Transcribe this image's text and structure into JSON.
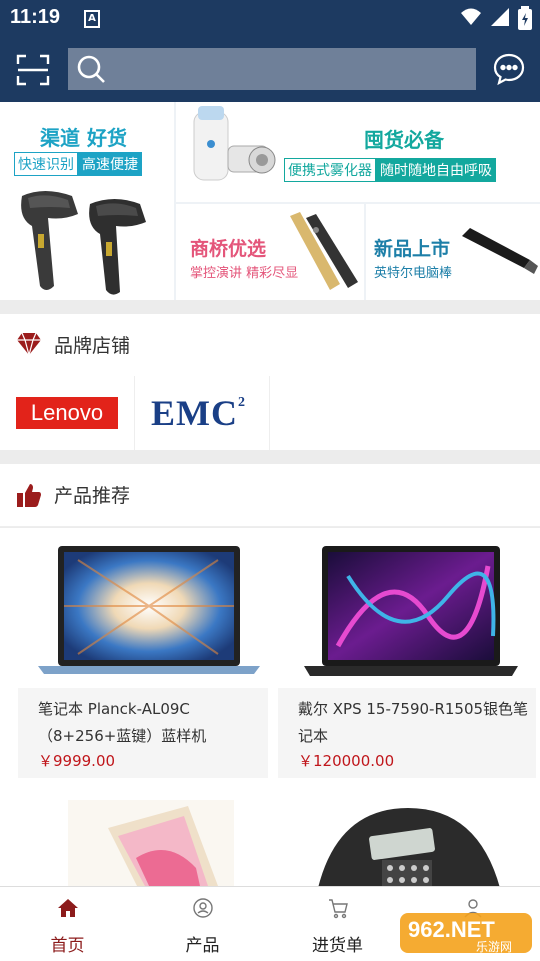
{
  "status_bar": {
    "time": "11:19",
    "notif_icon_letter": "A"
  },
  "search": {
    "placeholder": ""
  },
  "banner": {
    "tile1": {
      "title": "渠道 好货",
      "tag_a": "快速识别",
      "tag_b": "高速便捷"
    },
    "tile2": {
      "title": "囤货必备",
      "tag_a": "便携式雾化器",
      "tag_b": "随时随地自由呼吸"
    },
    "tile3": {
      "title": "商桥优选",
      "subtitle": "掌控演讲 精彩尽显"
    },
    "tile4": {
      "title": "新品上市",
      "subtitle": "英特尔电脑棒"
    }
  },
  "brand_section": {
    "title": "品牌店铺",
    "brands": [
      {
        "name": "Lenovo"
      },
      {
        "name": "EMC",
        "sup": "2"
      }
    ]
  },
  "product_section": {
    "title": "产品推荐",
    "items": [
      {
        "name": "笔记本 Planck-AL09C（8+256+蓝键）蓝样机",
        "price": "￥9999.00"
      },
      {
        "name": "戴尔 XPS 15-7590-R1505银色笔记本",
        "price": "￥120000.00"
      }
    ]
  },
  "tabs": [
    {
      "label": "首页",
      "icon": "home-icon"
    },
    {
      "label": "产品",
      "icon": "product-icon"
    },
    {
      "label": "进货单",
      "icon": "cart-icon"
    },
    {
      "label": "",
      "icon": "user-icon"
    }
  ],
  "watermark": {
    "text": "962.NET",
    "sub": "乐游网"
  },
  "colors": {
    "primary": "#1d3a61",
    "accent": "#8c1b1b",
    "price": "#c0161b"
  }
}
